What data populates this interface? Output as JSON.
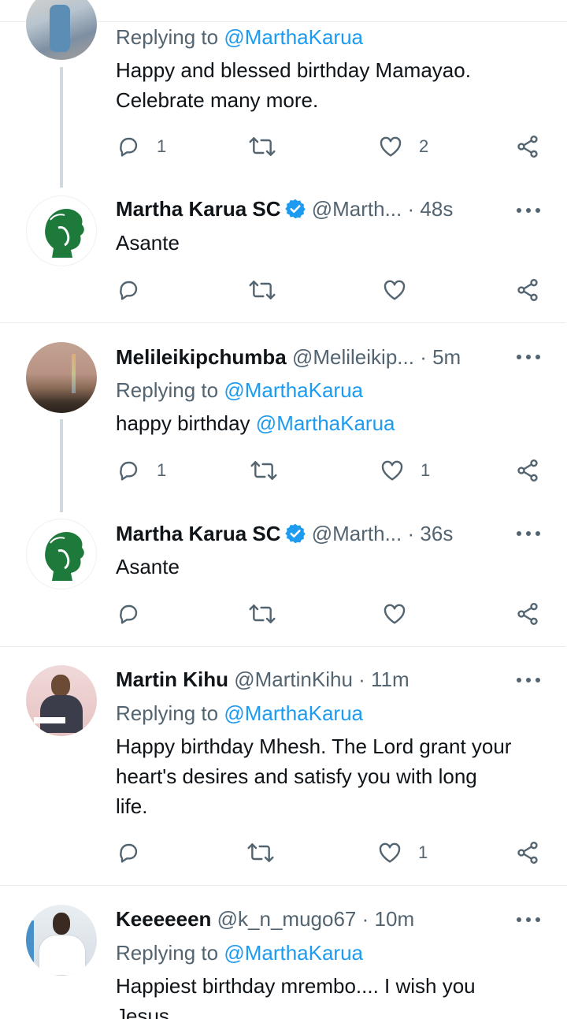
{
  "colors": {
    "accent": "#1d9bf0",
    "muted": "#536471",
    "text": "#0f1419",
    "divider": "#e6ecf0",
    "verified": "#1d9bf0"
  },
  "icons": {
    "reply": "reply-icon",
    "retweet": "retweet-icon",
    "like": "heart-icon",
    "share": "share-icon",
    "more": "more-icon",
    "verified": "verified-badge-icon"
  },
  "tweets": [
    {
      "replying_prefix": "Replying to ",
      "replying_handle": "@MarthaKarua",
      "text_lines": [
        "Happy and blessed birthday Mamayao.",
        "Celebrate many more."
      ],
      "reply_count": "1",
      "retweet_count": "",
      "like_count": "2"
    },
    {
      "name": "Martha Karua SC",
      "handle": "@Marth...",
      "separator": "·",
      "time": "48s",
      "text_lines": [
        "Asante"
      ],
      "reply_count": "",
      "retweet_count": "",
      "like_count": ""
    },
    {
      "name": "Melileikipchumba",
      "handle": "@Melileikip...",
      "separator": "·",
      "time": "5m",
      "replying_prefix": "Replying to ",
      "replying_handle": "@MarthaKarua",
      "text_prefix": "happy birthday ",
      "text_mention": "@MarthaKarua",
      "reply_count": "1",
      "retweet_count": "",
      "like_count": "1"
    },
    {
      "name": "Martha Karua SC",
      "handle": "@Marth...",
      "separator": "·",
      "time": "36s",
      "text_lines": [
        "Asante"
      ],
      "reply_count": "",
      "retweet_count": "",
      "like_count": ""
    },
    {
      "name": "Martin Kihu",
      "handle": "@MartinKihu",
      "separator": "·",
      "time": "11m",
      "replying_prefix": "Replying to ",
      "replying_handle": "@MarthaKarua",
      "text_lines": [
        "Happy birthday Mhesh. The Lord grant your",
        "heart's desires and satisfy you with long",
        "life."
      ],
      "reply_count": "",
      "retweet_count": "",
      "like_count": "1"
    },
    {
      "name": "Keeeeeen",
      "handle": "@k_n_mugo67",
      "separator": "·",
      "time": "10m",
      "replying_prefix": "Replying to ",
      "replying_handle": "@MarthaKarua",
      "text_lines": [
        "Happiest birthday mrembo.... I wish you",
        "Jesus"
      ]
    }
  ]
}
